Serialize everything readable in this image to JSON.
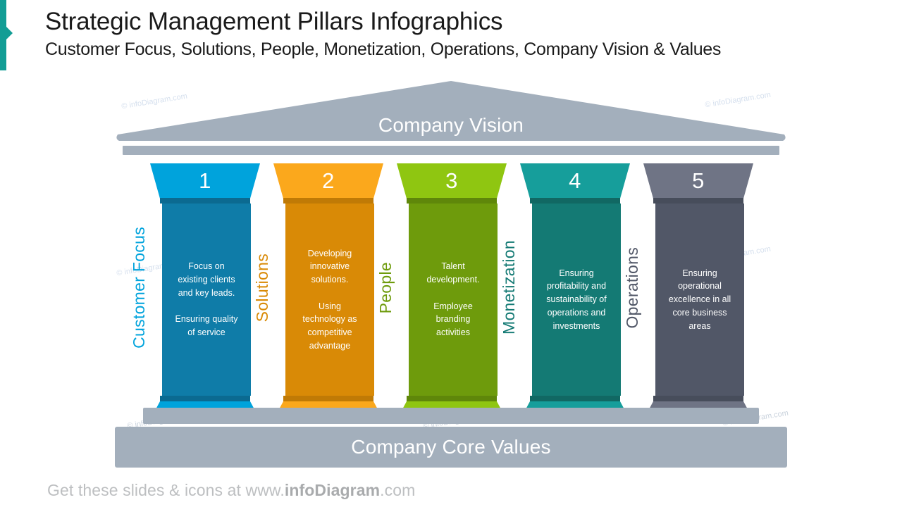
{
  "header": {
    "title": "Strategic Management Pillars Infographics",
    "subtitle": "Customer Focus, Solutions, People, Monetization, Operations, Company Vision & Values"
  },
  "temple": {
    "pediment_label": "Company Vision",
    "base_label": "Company Core Values",
    "structure_color": "#A3AFBC"
  },
  "pillars": [
    {
      "number": "1",
      "side_label": "Customer Focus",
      "body": "Focus on\nexisting clients\nand key leads.\n\nEnsuring quality\nof service",
      "capital_color": "#00A3DC",
      "shaft_color": "#0F7CA8",
      "accent_color": "#0B6A91",
      "label_color": "#00A3DC"
    },
    {
      "number": "2",
      "side_label": "Solutions",
      "body": "Developing\ninnovative\nsolutions.\n\nUsing\ntechnology as\ncompetitive\nadvantage",
      "capital_color": "#FBA81C",
      "shaft_color": "#D98A06",
      "accent_color": "#C07A05",
      "label_color": "#D98A06"
    },
    {
      "number": "3",
      "side_label": "People",
      "body": "Talent\ndevelopment.\n\nEmployee\nbranding\nactivities",
      "capital_color": "#8FC611",
      "shaft_color": "#6E9B0C",
      "accent_color": "#5F870A",
      "label_color": "#6E9B0C"
    },
    {
      "number": "4",
      "side_label": "Monetization",
      "body": "Ensuring\nprofitability and\nsustainability of\noperations and\ninvestments",
      "capital_color": "#169E9B",
      "shaft_color": "#147A74",
      "accent_color": "#116863",
      "label_color": "#147A74"
    },
    {
      "number": "5",
      "side_label": "Operations",
      "body": "Ensuring\noperational\nexcellence in all\ncore business\nareas",
      "capital_color": "#6F7485",
      "shaft_color": "#515767",
      "accent_color": "#474D5B",
      "label_color": "#515767"
    }
  ],
  "footer": {
    "prefix": "Get these slides & icons at www.",
    "brand": "infoDiagram",
    "suffix": ".com"
  },
  "watermark": {
    "text": "© infoDiagram.com"
  }
}
